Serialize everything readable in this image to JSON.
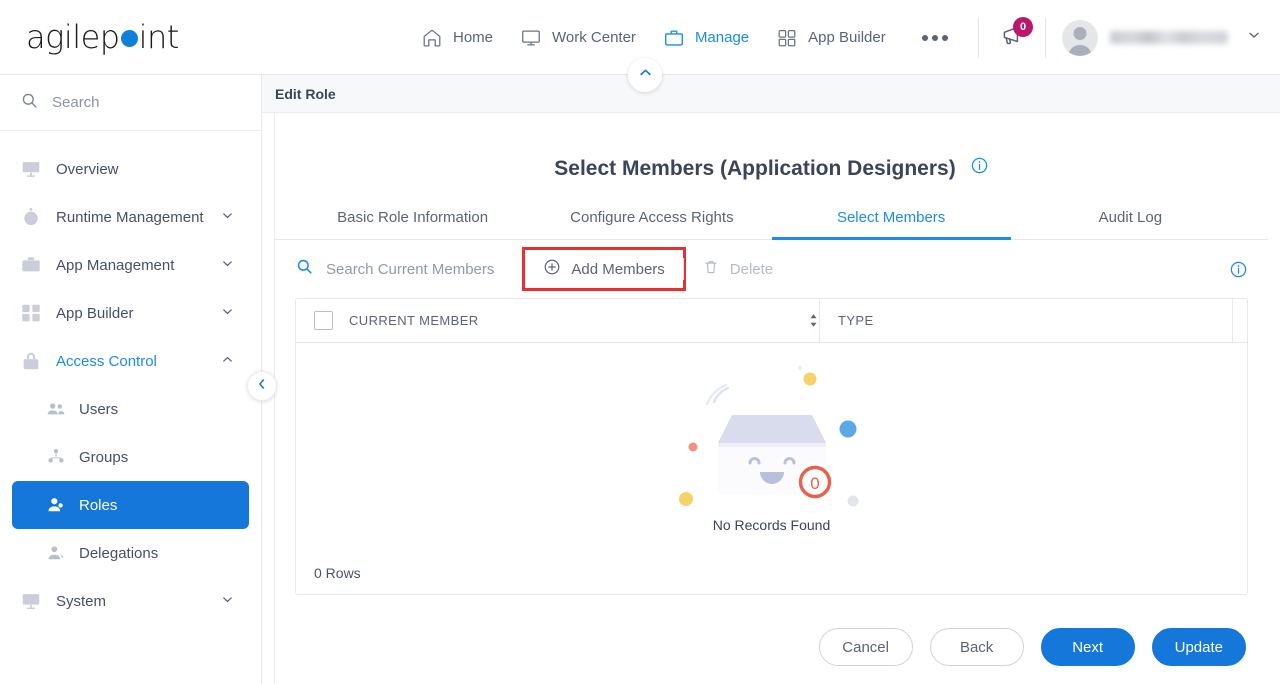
{
  "brand": {
    "name_part1": "agilep",
    "name_part2": "int",
    "dot_color": "#0f7fdb"
  },
  "topnav": {
    "items": [
      {
        "label": "Home",
        "icon": "home-icon",
        "active": false
      },
      {
        "label": "Work Center",
        "icon": "monitor-icon",
        "active": false
      },
      {
        "label": "Manage",
        "icon": "briefcase-icon",
        "active": true
      },
      {
        "label": "App Builder",
        "icon": "grid-icon",
        "active": false
      }
    ],
    "overflow_label": "more-options",
    "announcement": {
      "icon": "megaphone-icon",
      "badge_count": "0",
      "badge_color": "#b9186d"
    },
    "account": {
      "avatar": "user-avatar",
      "username": "",
      "chevron": "chevron-down-icon"
    }
  },
  "sidebar": {
    "search_placeholder": "Search",
    "items": [
      {
        "label": "Overview",
        "icon": "chart-monitor-icon",
        "expandable": false,
        "active": false
      },
      {
        "label": "Runtime Management",
        "icon": "stopwatch-icon",
        "expandable": true,
        "expanded": false,
        "active": false
      },
      {
        "label": "App Management",
        "icon": "briefcase-icon",
        "expandable": true,
        "expanded": false,
        "active": false
      },
      {
        "label": "App Builder",
        "icon": "grid-check-icon",
        "expandable": true,
        "expanded": false,
        "active": false
      },
      {
        "label": "Access Control",
        "icon": "lock-icon",
        "expandable": true,
        "expanded": true,
        "active": true
      }
    ],
    "subitems": [
      {
        "label": "Users",
        "icon": "users-icon",
        "selected": false
      },
      {
        "label": "Groups",
        "icon": "group-icon",
        "selected": false
      },
      {
        "label": "Roles",
        "icon": "role-user-icon",
        "selected": true
      },
      {
        "label": "Delegations",
        "icon": "delegation-icon",
        "selected": false
      }
    ],
    "trailing": [
      {
        "label": "System",
        "icon": "system-monitor-icon",
        "expandable": true,
        "expanded": false,
        "active": false
      }
    ],
    "collapse_icon": "chevron-left-icon"
  },
  "content": {
    "breadcrumb": "Edit Role",
    "collapse_top_icon": "chevron-up-icon",
    "page_title": "Select Members (Application Designers)",
    "title_info_icon": "info-icon",
    "tabs": [
      {
        "label": "Basic Role Information",
        "active": false
      },
      {
        "label": "Configure Access Rights",
        "active": false
      },
      {
        "label": "Select Members",
        "active": true
      },
      {
        "label": "Audit Log",
        "active": false
      }
    ],
    "toolbar": {
      "search_placeholder": "Search Current Members",
      "search_icon": "search-icon",
      "add_members_label": "Add Members",
      "add_members_icon": "plus-circle-icon",
      "add_members_highlight_color": "#e83030",
      "delete_label": "Delete",
      "delete_icon": "trash-icon",
      "delete_disabled": true,
      "info_icon": "info-icon"
    },
    "table": {
      "columns": [
        {
          "label": "CURRENT MEMBER",
          "sortable": true
        },
        {
          "label": "TYPE",
          "sortable": false
        }
      ],
      "rows": [],
      "empty_message": "No Records Found",
      "empty_badge_count": "0",
      "row_count_label": "0 Rows"
    },
    "footer_buttons": [
      {
        "label": "Cancel",
        "style": "outline"
      },
      {
        "label": "Back",
        "style": "outline"
      },
      {
        "label": "Next",
        "style": "primary"
      },
      {
        "label": "Update",
        "style": "primary"
      }
    ]
  }
}
